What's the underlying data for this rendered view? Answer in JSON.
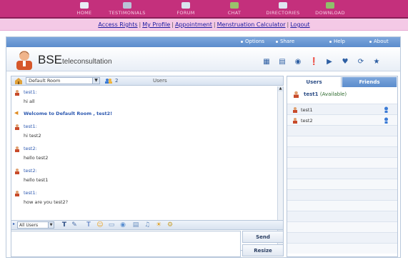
{
  "topnav": {
    "items": [
      {
        "label": "HOME",
        "icon": "home-icon"
      },
      {
        "label": "TESTIMONIALS",
        "icon": "testimonials-icon"
      },
      {
        "label": "FORUM",
        "icon": "forum-icon"
      },
      {
        "label": "CHAT",
        "icon": "chat-icon"
      },
      {
        "label": "DIRECTORIES",
        "icon": "directories-icon"
      },
      {
        "label": "DOWNLOAD",
        "icon": "download-icon"
      }
    ]
  },
  "links": {
    "items": [
      "Access Rights",
      "My Profile",
      "Appointment",
      "Menstruation Calculator",
      "Logout"
    ]
  },
  "optbar": {
    "items": [
      "Options",
      "Share",
      "Help",
      "About"
    ]
  },
  "brand": {
    "main": "BSE",
    "sub": "teleconsultation"
  },
  "chat": {
    "room": "Default Room",
    "user_count": "2",
    "users_label": "Users",
    "recipient": "All Users",
    "send_label": "Send",
    "reset_label": "Resize"
  },
  "messages": [
    {
      "who": "test1:",
      "text": "hi all"
    },
    {
      "welcome": "Welcome to Default Room , test2!"
    },
    {
      "who": "test1:",
      "text": "hi test2"
    },
    {
      "who": "test2:",
      "text": "hello test2"
    },
    {
      "who": "test2:",
      "text": "hello test1"
    },
    {
      "who": "test1:",
      "text": "how are you test2?"
    }
  ],
  "users_panel": {
    "tab_users": "Users",
    "tab_friends": "Friends",
    "me_name": "test1",
    "me_status": "(Available)",
    "users": [
      "test1",
      "test2"
    ]
  },
  "colors": {
    "nav_bg": "#c4307c",
    "linkbar_bg": "#f4c9e6",
    "accent_blue": "#5b8ccc"
  }
}
